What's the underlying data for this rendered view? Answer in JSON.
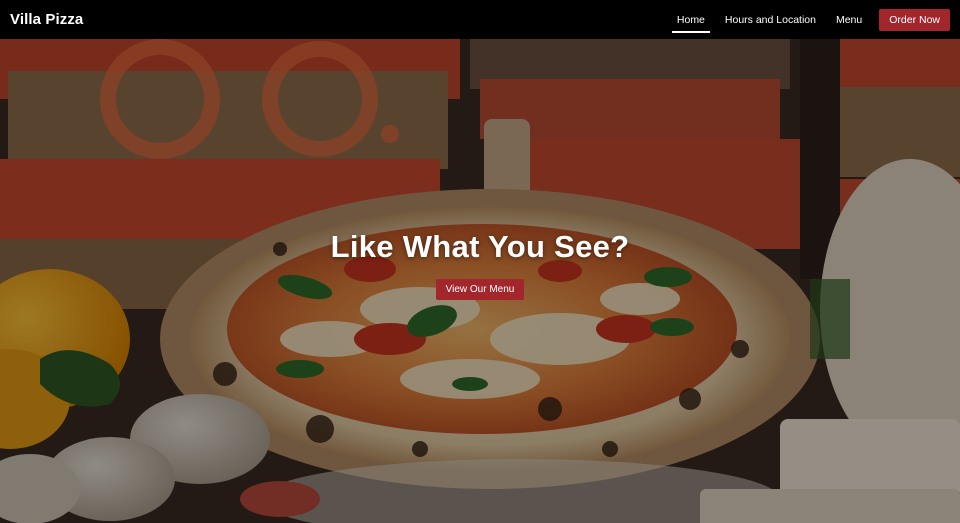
{
  "nav": {
    "brand": "Villa Pizza",
    "links": [
      {
        "label": "Home",
        "active": true
      },
      {
        "label": "Hours and Location",
        "active": false
      },
      {
        "label": "Menu",
        "active": false
      }
    ],
    "order_button": "Order Now"
  },
  "hero": {
    "title": "Like What You See?",
    "button": "View Our Menu",
    "background_image": "pizza-photo"
  },
  "colors": {
    "accent": "#a3262d",
    "navbar_bg": "#000000",
    "text": "#ffffff"
  }
}
